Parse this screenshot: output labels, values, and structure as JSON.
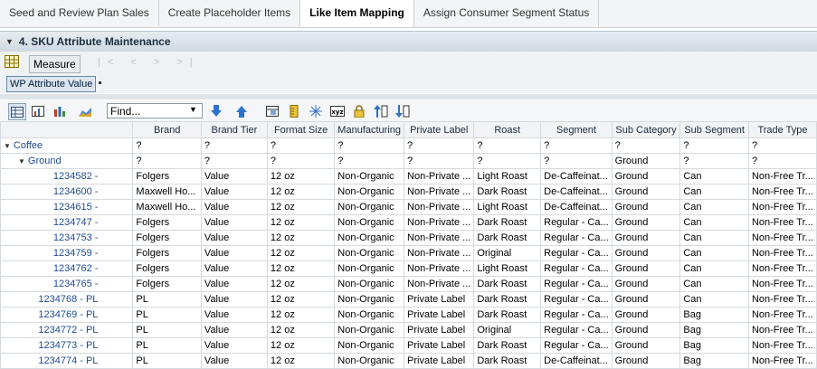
{
  "tabs": [
    {
      "label": "Seed and Review Plan Sales",
      "active": false
    },
    {
      "label": "Create Placeholder Items",
      "active": false
    },
    {
      "label": "Like Item Mapping",
      "active": true
    },
    {
      "label": "Assign Consumer Segment Status",
      "active": false
    }
  ],
  "panel": {
    "title": "4. SKU Attribute Maintenance"
  },
  "controls": {
    "measure_label": "Measure",
    "nav": "|< < > >|",
    "measure_chip": "WP Attribute Value"
  },
  "toolbar": {
    "find_placeholder": "Find..."
  },
  "columns": [
    "Brand",
    "Brand Tier",
    "Format Size",
    "Manufacturing",
    "Private Label",
    "Roast",
    "Segment",
    "Sub Category",
    "Sub Segment",
    "Trade Type"
  ],
  "rows": [
    {
      "label": "Coffee",
      "level": 0,
      "cells": [
        "?",
        "?",
        "?",
        "?",
        "?",
        "?",
        "?",
        "?",
        "?",
        "?"
      ]
    },
    {
      "label": "Ground",
      "level": 1,
      "cells": [
        "?",
        "?",
        "?",
        "?",
        "?",
        "?",
        "?",
        "Ground",
        "?",
        "?"
      ]
    },
    {
      "label": "1234582 -",
      "level": 2,
      "cells": [
        "Folgers",
        "Value",
        "12 oz",
        "Non-Organic",
        "Non-Private ...",
        "Light Roast",
        "De-Caffeinat...",
        "Ground",
        "Can",
        "Non-Free Tr..."
      ]
    },
    {
      "label": "1234600 -",
      "level": 2,
      "cells": [
        "Maxwell Ho...",
        "Value",
        "12 oz",
        "Non-Organic",
        "Non-Private ...",
        "Dark Roast",
        "De-Caffeinat...",
        "Ground",
        "Can",
        "Non-Free Tr..."
      ]
    },
    {
      "label": "1234615 -",
      "level": 2,
      "cells": [
        "Maxwell Ho...",
        "Value",
        "12 oz",
        "Non-Organic",
        "Non-Private ...",
        "Light Roast",
        "De-Caffeinat...",
        "Ground",
        "Can",
        "Non-Free Tr..."
      ]
    },
    {
      "label": "1234747 -",
      "level": 2,
      "cells": [
        "Folgers",
        "Value",
        "12 oz",
        "Non-Organic",
        "Non-Private ...",
        "Dark Roast",
        "Regular - Ca...",
        "Ground",
        "Can",
        "Non-Free Tr..."
      ]
    },
    {
      "label": "1234753 -",
      "level": 2,
      "cells": [
        "Folgers",
        "Value",
        "12 oz",
        "Non-Organic",
        "Non-Private ...",
        "Dark Roast",
        "Regular - Ca...",
        "Ground",
        "Can",
        "Non-Free Tr..."
      ]
    },
    {
      "label": "1234759 -",
      "level": 2,
      "cells": [
        "Folgers",
        "Value",
        "12 oz",
        "Non-Organic",
        "Non-Private ...",
        "Original",
        "Regular - Ca...",
        "Ground",
        "Can",
        "Non-Free Tr..."
      ]
    },
    {
      "label": "1234762 -",
      "level": 2,
      "cells": [
        "Folgers",
        "Value",
        "12 oz",
        "Non-Organic",
        "Non-Private ...",
        "Light Roast",
        "Regular - Ca...",
        "Ground",
        "Can",
        "Non-Free Tr..."
      ]
    },
    {
      "label": "1234765 -",
      "level": 2,
      "cells": [
        "Folgers",
        "Value",
        "12 oz",
        "Non-Organic",
        "Non-Private ...",
        "Dark Roast",
        "Regular - Ca...",
        "Ground",
        "Can",
        "Non-Free Tr..."
      ]
    },
    {
      "label": "1234768 - PL",
      "level": 2,
      "cells": [
        "PL",
        "Value",
        "12 oz",
        "Non-Organic",
        "Private Label",
        "Dark Roast",
        "Regular - Ca...",
        "Ground",
        "Can",
        "Non-Free Tr..."
      ]
    },
    {
      "label": "1234769 - PL",
      "level": 2,
      "cells": [
        "PL",
        "Value",
        "12 oz",
        "Non-Organic",
        "Private Label",
        "Dark Roast",
        "Regular - Ca...",
        "Ground",
        "Bag",
        "Non-Free Tr..."
      ]
    },
    {
      "label": "1234772 - PL",
      "level": 2,
      "cells": [
        "PL",
        "Value",
        "12 oz",
        "Non-Organic",
        "Private Label",
        "Original",
        "Regular - Ca...",
        "Ground",
        "Bag",
        "Non-Free Tr..."
      ]
    },
    {
      "label": "1234773 - PL",
      "level": 2,
      "cells": [
        "PL",
        "Value",
        "12 oz",
        "Non-Organic",
        "Private Label",
        "Dark Roast",
        "Regular - Ca...",
        "Ground",
        "Bag",
        "Non-Free Tr..."
      ]
    },
    {
      "label": "1234774 - PL",
      "level": 2,
      "cells": [
        "PL",
        "Value",
        "12 oz",
        "Non-Organic",
        "Private Label",
        "Dark Roast",
        "De-Caffeinat...",
        "Ground",
        "Bag",
        "Non-Free Tr..."
      ]
    }
  ]
}
